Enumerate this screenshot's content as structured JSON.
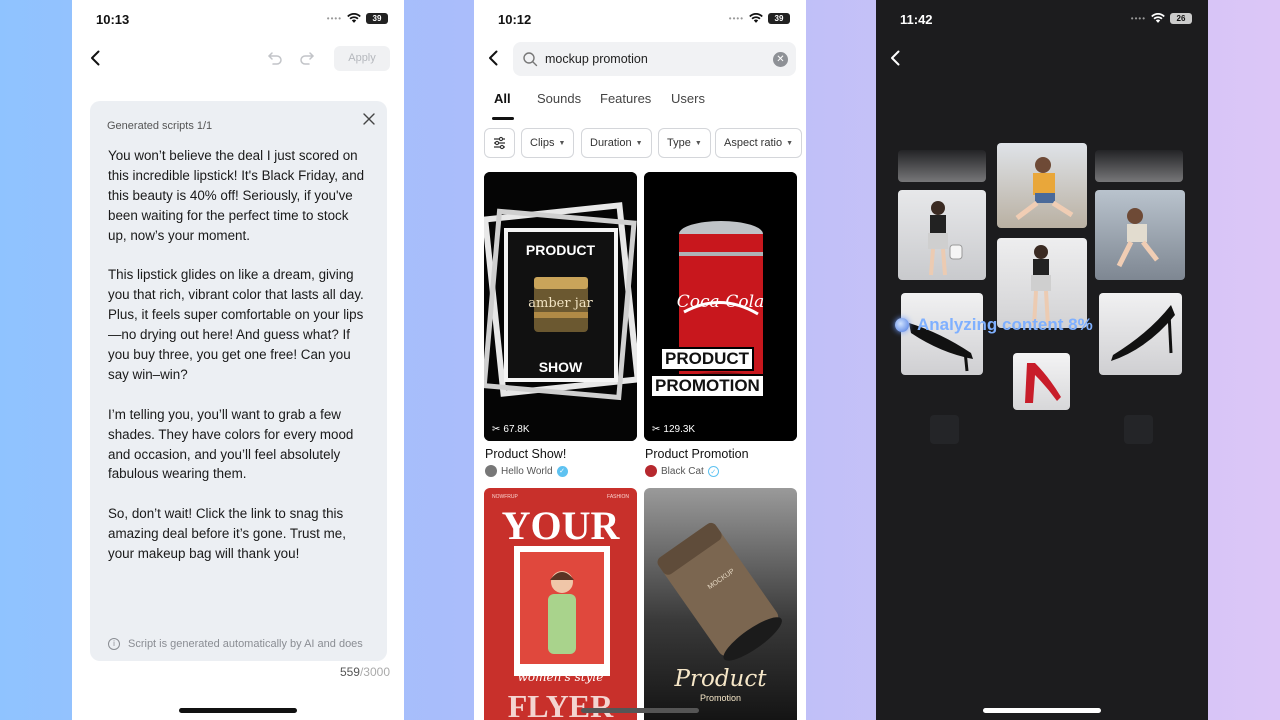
{
  "left_phone": {
    "status": {
      "time": "10:13",
      "battery": "39"
    },
    "toolbar": {
      "apply_label": "Apply"
    },
    "card": {
      "header": "Generated scripts 1/1",
      "paragraphs": [
        "You won’t believe the deal I just scored on this incredible lipstick! It's Black Friday, and this beauty is 40% off! Seriously, if you've been waiting for the perfect time to stock up, now’s your moment.",
        "This lipstick glides on like a dream, giving you that rich, vibrant color that lasts all day. Plus, it feels super comfortable on your lips—no drying out here! And guess what? If you buy three, you get one free! Can you say win–win?",
        "I’m telling you, you’ll want to grab a few shades. They have colors for every mood and occasion, and you’ll feel absolutely fabulous wearing them.",
        "So, don’t wait! Click the link to snag this amazing deal before it’s gone. Trust me, your makeup bag will thank you!"
      ],
      "disclaimer": "Script is generated automatically by AI and does"
    },
    "char_count": {
      "current": "559",
      "max": "/3000"
    }
  },
  "middle_phone": {
    "status": {
      "time": "10:12",
      "battery": "39"
    },
    "search": {
      "query": "mockup promotion",
      "clear_glyph": "✕"
    },
    "tabs": [
      "All",
      "Sounds",
      "Features",
      "Users"
    ],
    "filters": [
      "Clips",
      "Duration",
      "Type",
      "Aspect ratio"
    ],
    "cards": [
      {
        "title": "Product Show!",
        "author": "Hello World",
        "usage": "67.8K",
        "thumb_top": "PRODUCT",
        "thumb_bottom": "SHOW",
        "jar_label": "amber jar"
      },
      {
        "title": "Product Promotion",
        "author": "Black Cat",
        "usage": "129.3K",
        "thumb_text_1": "PRODUCT",
        "thumb_text_2": "PROMOTION",
        "can_label": "Coca-Cola"
      },
      {
        "thumb_big": "YOUR",
        "thumb_script": "women's style",
        "thumb_bottom": "FLYER",
        "thumb_tiny_left": "NOWFRUP",
        "thumb_tiny_right": "FASHION"
      },
      {
        "thumb_script": "Product",
        "thumb_sub": "Promotion",
        "cup_label": "MOCKUP"
      }
    ]
  },
  "right_phone": {
    "status": {
      "time": "11:42",
      "battery": "26"
    },
    "analyzing": {
      "label": "Analyzing content 8%",
      "progress_percent": 8
    }
  },
  "colors": {
    "accent_blue": "#5ec2f1",
    "analyze_text": "#7fb0ff",
    "dark_bg": "#1c1c1e"
  }
}
